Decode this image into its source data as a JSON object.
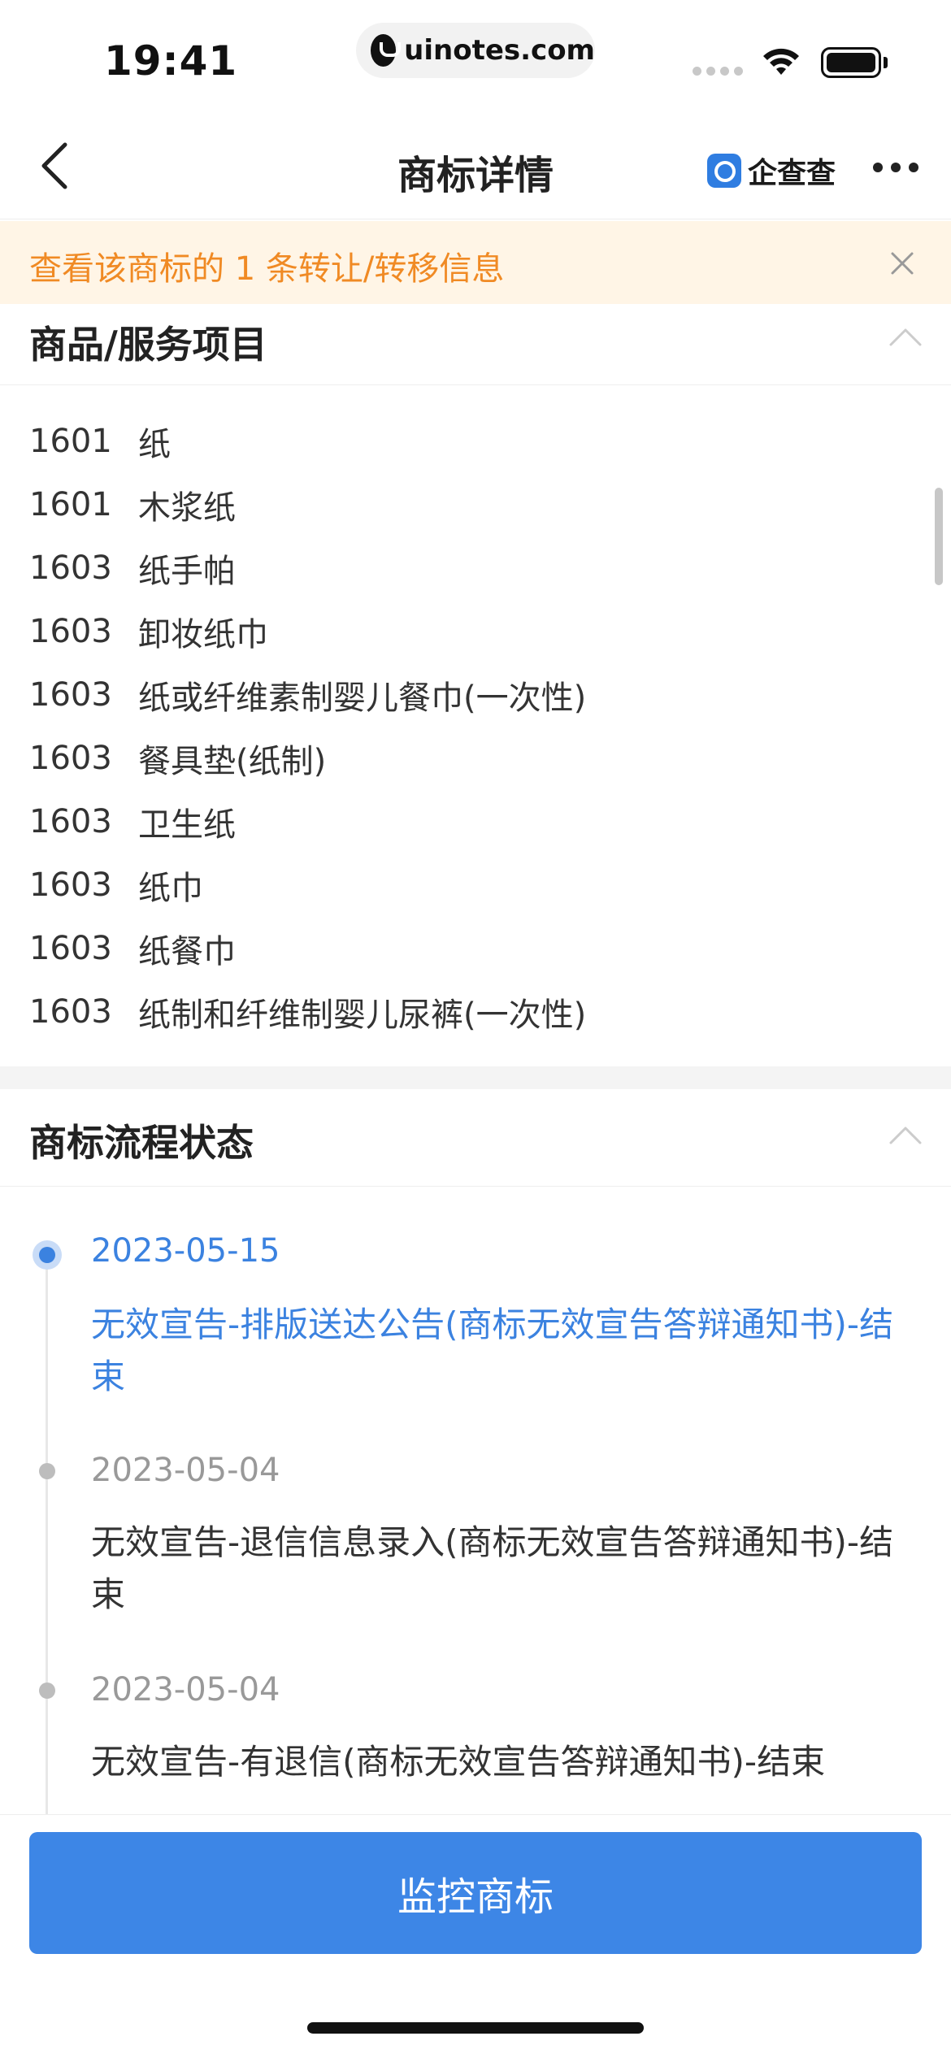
{
  "status_bar": {
    "time": "19:41",
    "url": "uinotes.com"
  },
  "nav": {
    "title": "商标详情",
    "brand": "企查查"
  },
  "banner": {
    "text": "查看该商标的 1 条转让/转移信息"
  },
  "goods_section": {
    "title": "商品/服务项目",
    "items": [
      {
        "code": "1601",
        "name": "纸"
      },
      {
        "code": "1601",
        "name": "木浆纸"
      },
      {
        "code": "1603",
        "name": "纸手帕"
      },
      {
        "code": "1603",
        "name": "卸妆纸巾"
      },
      {
        "code": "1603",
        "name": "纸或纤维素制婴儿餐巾(一次性)"
      },
      {
        "code": "1603",
        "name": "餐具垫(纸制)"
      },
      {
        "code": "1603",
        "name": "卫生纸"
      },
      {
        "code": "1603",
        "name": "纸巾"
      },
      {
        "code": "1603",
        "name": "纸餐巾"
      },
      {
        "code": "1603",
        "name": "纸制和纤维制婴儿尿裤(一次性)"
      }
    ]
  },
  "status_section": {
    "title": "商标流程状态",
    "events": [
      {
        "date": "2023-05-15",
        "desc": "无效宣告-排版送达公告(商标无效宣告答辩通知书)-结束",
        "active": true
      },
      {
        "date": "2023-05-04",
        "desc": "无效宣告-退信信息录入(商标无效宣告答辩通知书)-结束",
        "active": false
      },
      {
        "date": "2023-05-04",
        "desc": "无效宣告-有退信(商标无效宣告答辩通知书)-结束",
        "active": false
      }
    ]
  },
  "bottom": {
    "button_label": "监控商标"
  },
  "colors": {
    "accent": "#3b82e0",
    "banner_bg": "#fff5e6",
    "banner_text": "#f08a24"
  }
}
